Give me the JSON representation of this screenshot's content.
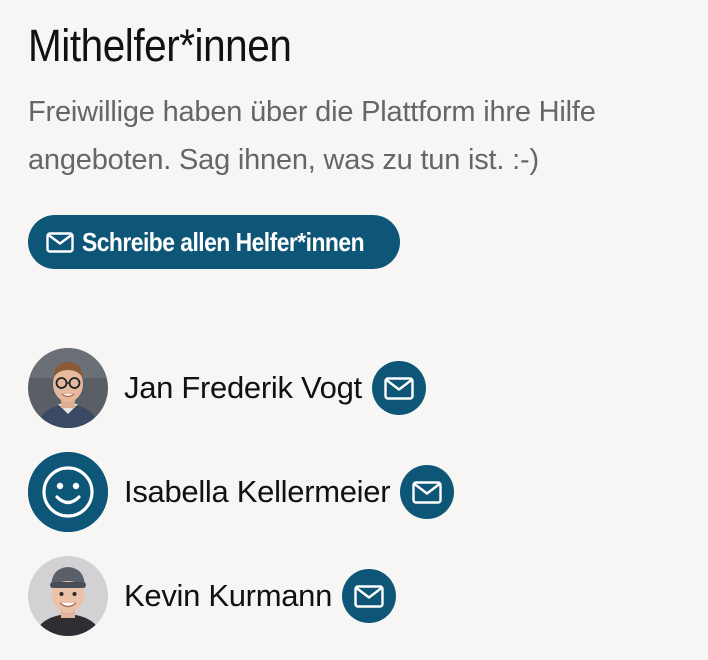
{
  "section": {
    "title": "Mithelfer*innen",
    "description": "Freiwillige haben über die Plattform ihre Hilfe angeboten. Sag ihnen, was zu tun ist. :-)"
  },
  "cta": {
    "label": "Schreibe allen Helfer*innen",
    "icon": "envelope-icon"
  },
  "helpers": [
    {
      "name": "Jan Frederik Vogt",
      "avatar": "photo"
    },
    {
      "name": "Isabella Kellermeier",
      "avatar": "smiley-icon"
    },
    {
      "name": "Kevin Kurmann",
      "avatar": "photo"
    }
  ],
  "colors": {
    "accent": "#0e5677",
    "background": "#f8f6f5",
    "text": "#111111",
    "muted_text": "#666666"
  }
}
